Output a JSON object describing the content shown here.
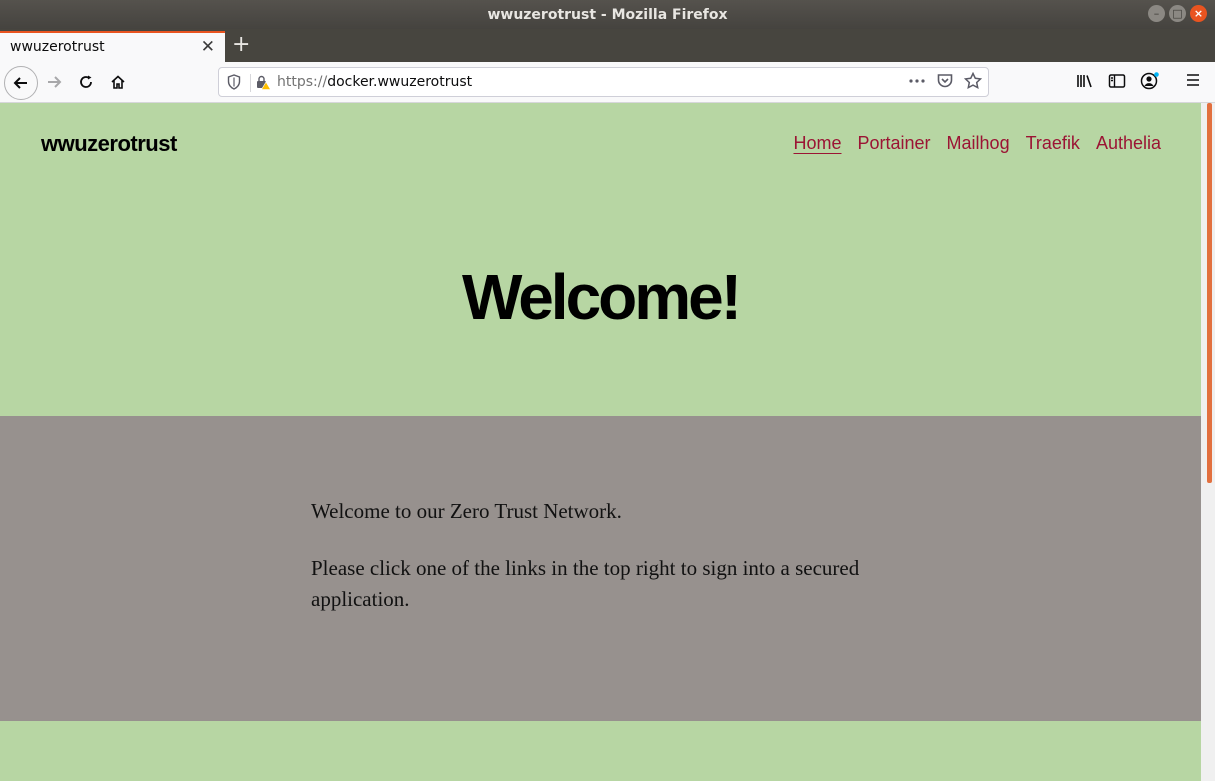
{
  "window": {
    "title": "wwuzerotrust - Mozilla Firefox",
    "controls": [
      "minimize-icon",
      "maximize-icon",
      "close-icon"
    ]
  },
  "tabs": [
    {
      "title": "wwuzerotrust",
      "active": true
    }
  ],
  "toolbar": {
    "url_protocol": "https://",
    "url_host": "docker.wwuzerotrust",
    "icons": [
      "back-icon",
      "forward-icon",
      "reload-icon",
      "home-icon",
      "shield-icon",
      "lock-warning-icon",
      "more-actions-icon",
      "pocket-icon",
      "bookmark-star-icon",
      "library-icon",
      "sidebar-icon",
      "account-icon",
      "menu-icon"
    ]
  },
  "page": {
    "site_title": "wwuzerotrust",
    "nav": [
      {
        "label": "Home",
        "active": true
      },
      {
        "label": "Portainer"
      },
      {
        "label": "Mailhog"
      },
      {
        "label": "Traefik"
      },
      {
        "label": "Authelia"
      }
    ],
    "heading": "Welcome!",
    "paragraphs": [
      "Welcome to our Zero Trust Network.",
      "Please click one of the links in the top right to sign into a secured application."
    ]
  },
  "colors": {
    "hero_bg": "#b7d6a3",
    "content_bg": "#97918e",
    "link": "#9b1434",
    "accent": "#e95420"
  }
}
